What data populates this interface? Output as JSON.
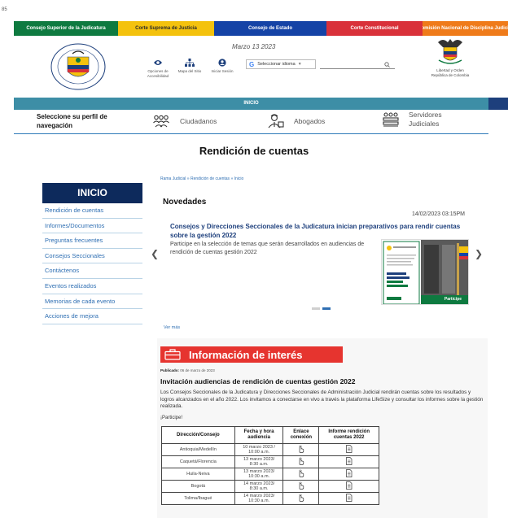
{
  "top_strip": {
    "tab_number": "85"
  },
  "entities": [
    {
      "label": "Consejo Superior de la Judicatura"
    },
    {
      "label": "Corte Suprema de Justicia"
    },
    {
      "label": "Consejo de Estado"
    },
    {
      "label": "Corte Constitucional"
    },
    {
      "label": "Comisión Nacional de Disciplina Judicial"
    }
  ],
  "header": {
    "date": "Marzo 13 2023",
    "tools": [
      {
        "label": "Opciones de Accesibilidad",
        "icon": "eye-icon"
      },
      {
        "label": "Mapa del Sitio",
        "icon": "sitemap-icon"
      },
      {
        "label": "Iniciar Sesión",
        "icon": "user-icon"
      }
    ],
    "language_select": "Seleccionar idioma",
    "escudo_text": "Libertad y Orden República de Colombia",
    "colors": {
      "seal_blue": "#1d3f7c",
      "seal_yellow": "#f4c20d"
    }
  },
  "navbar": {
    "label": "INICIO"
  },
  "profiles": {
    "title": "Seleccione su perfil de navegación",
    "items": [
      {
        "label": "Ciudadanos"
      },
      {
        "label": "Abogados"
      },
      {
        "label": "Servidores Judiciales"
      }
    ]
  },
  "page_title": "Rendición de cuentas",
  "breadcrumb": {
    "a": "Rama Judicial",
    "sep": "»",
    "b": "Rendición de cuentas",
    "current": "Inicio"
  },
  "sidebar": {
    "title": "INICIO",
    "items": [
      {
        "label": "Rendición de cuentas"
      },
      {
        "label": "Informes/Documentos"
      },
      {
        "label": "Preguntas frecuentes"
      },
      {
        "label": "Consejos Seccionales"
      },
      {
        "label": "Contáctenos"
      },
      {
        "label": "Eventos realizados"
      },
      {
        "label": "Memorias de cada evento"
      },
      {
        "label": "Acciones de mejora"
      }
    ]
  },
  "novedades": {
    "title": "Novedades",
    "date": "14/02/2023 03:15PM",
    "headline": "Consejos y Direcciones Seccionales de la Judicatura inician preparativos para rendir cuentas sobre la gestión 2022",
    "summary": "Participe en la selección de temas que serán desarrollados en audiencias de rendición de cuentas gestión 2022",
    "image_caption": "Participe",
    "more_link": "Ver más"
  },
  "info": {
    "banner": "Información de interés",
    "published_label": "Publicado:",
    "published_date": "06 de marzo de 2023",
    "title": "Invitación audiencias de rendición de cuentas gestión 2022",
    "body": "Los Consejos Seccionales de la Judicatura y Direcciones Seccionales de Administración Judicial rendirán cuentas sobre los resultados y logros alcanzados en el año 2022. Los invitamos a conectarse en vivo a través la plataforma LifeSize y consultar los informes sobre la gestión realizada.",
    "participe": "¡Participe!",
    "table": {
      "headers": [
        "Dirección/Consejo",
        "Fecha y hora audiencia",
        "Enlace conexión",
        "Informe rendición cuentas 2022"
      ],
      "rows": [
        {
          "place": "Antioquia/Medellín",
          "date": "10 marzo 2023 /",
          "time": "10:00 a.m."
        },
        {
          "place": "Caquetá/Florencia",
          "date": "13 marzo 2023/",
          "time": "8:30 a.m."
        },
        {
          "place": "Huila-Neiva",
          "date": "13 marzo 2023/",
          "time": "10:30 a.m."
        },
        {
          "place": "Bogotá",
          "date": "14 marzo 2023/",
          "time": "8:30 a.m."
        },
        {
          "place": "Tolima/Ibagué",
          "date": "14 marzo 2023/",
          "time": "10:30 a.m."
        }
      ]
    }
  }
}
